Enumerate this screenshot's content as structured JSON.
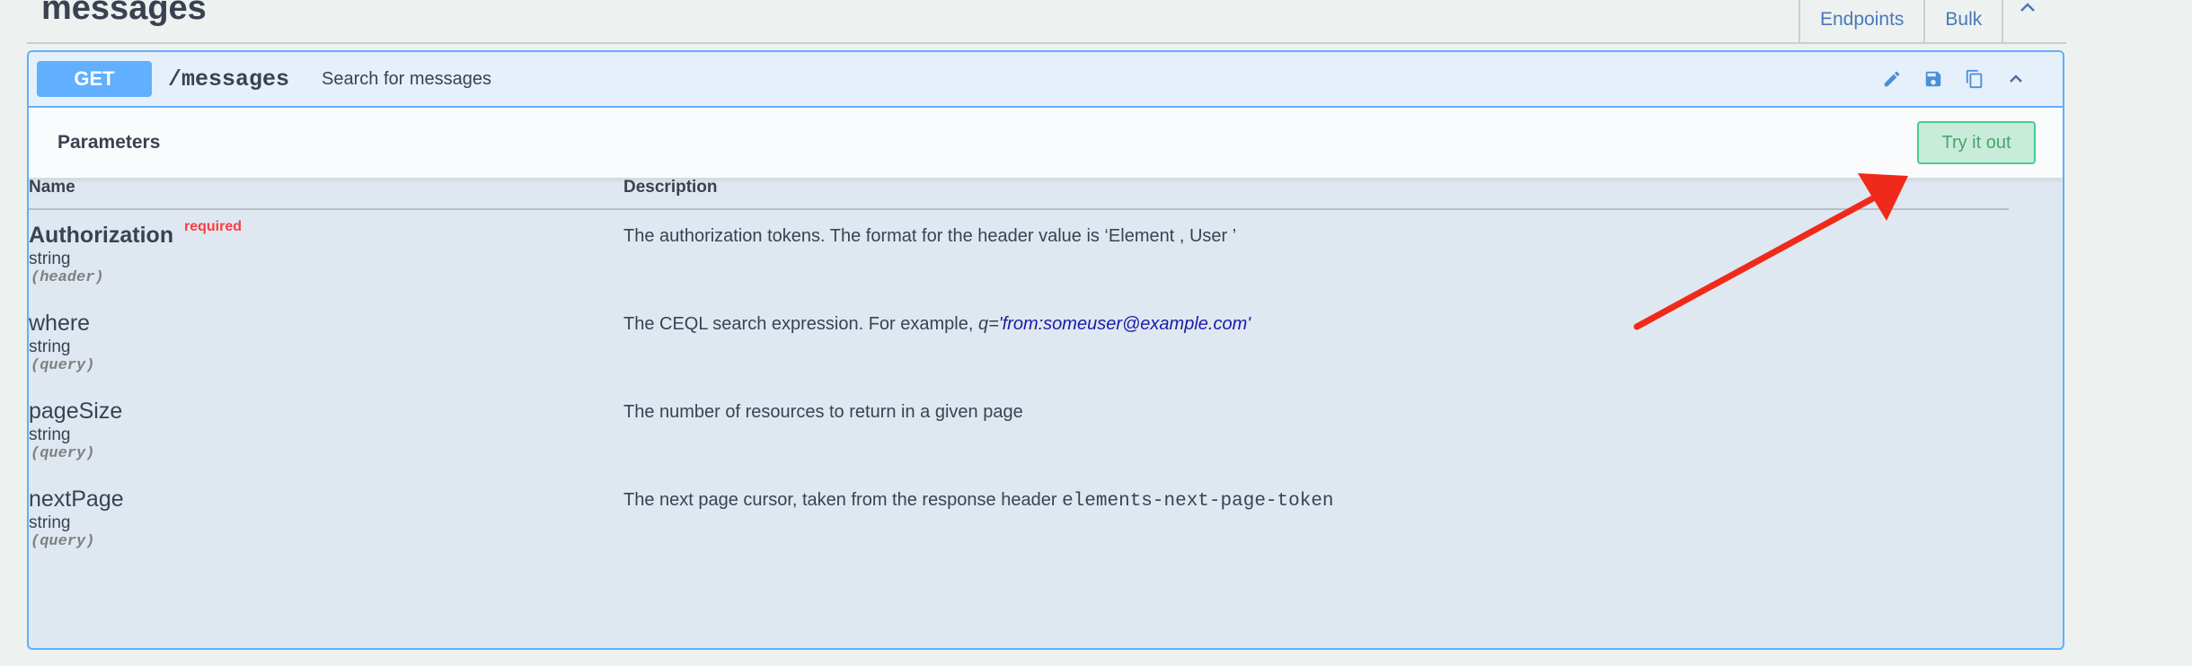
{
  "tag": {
    "title": "messages"
  },
  "tabs": [
    {
      "label": "Endpoints"
    },
    {
      "label": "Bulk"
    }
  ],
  "operation": {
    "method": "GET",
    "path": "/messages",
    "summary": "Search for messages",
    "icons": [
      "edit-icon",
      "save-icon",
      "copy-icon",
      "collapse-icon"
    ]
  },
  "parameters": {
    "title": "Parameters",
    "try_button": "Try it out",
    "columns": {
      "name": "Name",
      "description": "Description"
    },
    "rows": [
      {
        "name": "Authorization",
        "required_label": "required",
        "type": "string",
        "in": "(header)",
        "description": "The authorization tokens. The format for the header value is ‘Element , User ’"
      },
      {
        "name": "where",
        "type": "string",
        "in": "(query)",
        "description_prefix": "The CEQL search expression. For example, ",
        "description_example_key": "q=",
        "description_example_value": "'from:someuser@example.com'"
      },
      {
        "name": "pageSize",
        "type": "string",
        "in": "(query)",
        "description": "The number of resources to return in a given page"
      },
      {
        "name": "nextPage",
        "type": "string",
        "in": "(query)",
        "description_prefix": "The next page cursor, taken from the response header ",
        "description_code": "elements-next-page-token"
      }
    ]
  },
  "colors": {
    "get_accent": "#61affe",
    "try_button_border": "#49cc90",
    "required": "#f93e3e",
    "annotation_arrow": "#f02a1a"
  }
}
